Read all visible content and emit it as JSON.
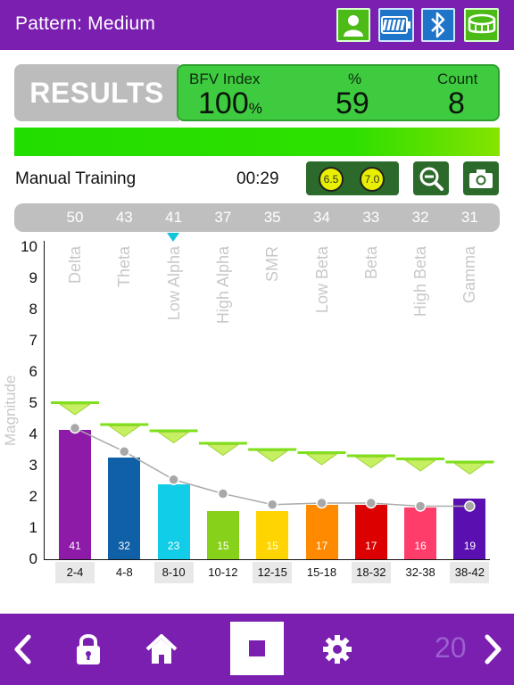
{
  "header": {
    "title": "Pattern: Medium",
    "icons": [
      "user-icon",
      "battery-icon",
      "bluetooth-icon",
      "headband-icon"
    ]
  },
  "results": {
    "button_label": "RESULTS",
    "bfv_label": "BFV Index",
    "bfv_value": "100",
    "bfv_unit": "%",
    "pct_label": "%",
    "pct_value": "59",
    "count_label": "Count",
    "count_value": "8"
  },
  "training": {
    "mode_label": "Manual Training",
    "timer": "00:29",
    "threshold_low": "6.5",
    "threshold_high": "7.0"
  },
  "band_values": [
    "50",
    "43",
    "41",
    "37",
    "35",
    "34",
    "33",
    "32",
    "31"
  ],
  "chart_data": {
    "type": "bar",
    "ylabel": "Magnitude",
    "ylim": [
      0,
      10
    ],
    "yticks": [
      "0",
      "1",
      "2",
      "3",
      "4",
      "5",
      "6",
      "7",
      "8",
      "9",
      "10"
    ],
    "band_names": [
      "Delta",
      "Theta",
      "Low Alpha",
      "High Alpha",
      "SMR",
      "Low Beta",
      "Beta",
      "High Beta",
      "Gamma"
    ],
    "categories": [
      "2-4",
      "4-8",
      "8-10",
      "10-12",
      "12-15",
      "15-18",
      "18-32",
      "32-38",
      "38-42"
    ],
    "values": [
      4.15,
      3.25,
      2.4,
      1.55,
      1.55,
      1.75,
      1.75,
      1.65,
      1.95
    ],
    "bar_labels": [
      "41",
      "32",
      "23",
      "15",
      "15",
      "17",
      "17",
      "16",
      "19"
    ],
    "bar_colors": [
      "#8e1aa8",
      "#1060a8",
      "#12cde8",
      "#88d11a",
      "#ffd400",
      "#ff8a00",
      "#dd0000",
      "#ff3d6a",
      "#5a0fb0"
    ],
    "thresholds": [
      5.0,
      4.3,
      4.1,
      3.7,
      3.5,
      3.4,
      3.3,
      3.2,
      3.1
    ],
    "average_line": [
      4.2,
      3.45,
      2.55,
      2.1,
      1.75,
      1.8,
      1.8,
      1.7,
      1.7
    ],
    "threshold_color": "#7de01a"
  },
  "footer": {
    "page_number": "20",
    "icons": [
      "back-arrow-icon",
      "lock-icon",
      "home-icon",
      "stop-icon",
      "settings-gear-icon",
      "forward-arrow-icon"
    ]
  }
}
